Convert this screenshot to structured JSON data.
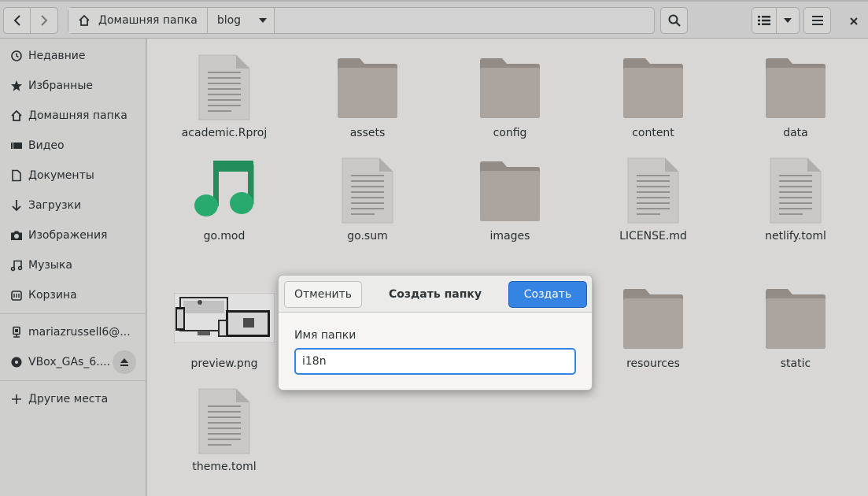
{
  "header": {
    "back_icon": "chevron-left-icon",
    "forward_icon": "chevron-right-icon",
    "breadcrumbs": [
      {
        "label": "Домашняя папка",
        "icon": "home-icon"
      },
      {
        "label": "blog"
      }
    ]
  },
  "sidebar": {
    "items": [
      {
        "label": "Недавние",
        "icon": "clock-icon"
      },
      {
        "label": "Избранные",
        "icon": "star-icon"
      },
      {
        "label": "Домашняя папка",
        "icon": "home-icon"
      },
      {
        "label": "Видео",
        "icon": "video-icon"
      },
      {
        "label": "Документы",
        "icon": "document-icon"
      },
      {
        "label": "Загрузки",
        "icon": "download-icon"
      },
      {
        "label": "Изображения",
        "icon": "camera-icon"
      },
      {
        "label": "Музыка",
        "icon": "music-icon"
      },
      {
        "label": "Корзина",
        "icon": "trash-icon"
      },
      {
        "label": "mariazrussell6@...",
        "icon": "network-drive-icon"
      },
      {
        "label": "VBox_GAs_6....",
        "icon": "disc-icon"
      },
      {
        "label": "Другие места",
        "icon": "plus-icon"
      }
    ]
  },
  "files": [
    {
      "name": "academic.Rproj",
      "kind": "document"
    },
    {
      "name": "assets",
      "kind": "folder"
    },
    {
      "name": "config",
      "kind": "folder"
    },
    {
      "name": "content",
      "kind": "folder"
    },
    {
      "name": "data",
      "kind": "folder"
    },
    {
      "name": "go.mod",
      "kind": "music"
    },
    {
      "name": "go.sum",
      "kind": "document"
    },
    {
      "name": "images",
      "kind": "folder"
    },
    {
      "name": "LICENSE.md",
      "kind": "document"
    },
    {
      "name": "netlify.toml",
      "kind": "document"
    },
    {
      "name": "preview.png",
      "kind": "image"
    },
    {
      "name": "resources",
      "kind": "folder"
    },
    {
      "name": "static",
      "kind": "folder"
    },
    {
      "name": "theme.toml",
      "kind": "document"
    }
  ],
  "dialog": {
    "title": "Создать папку",
    "cancel_label": "Отменить",
    "create_label": "Создать",
    "field_label": "Имя папки",
    "field_value": "i18n"
  },
  "colors": {
    "accent": "#3584e4",
    "folder": "#bfb5ad",
    "music_icon": "#26a269"
  }
}
